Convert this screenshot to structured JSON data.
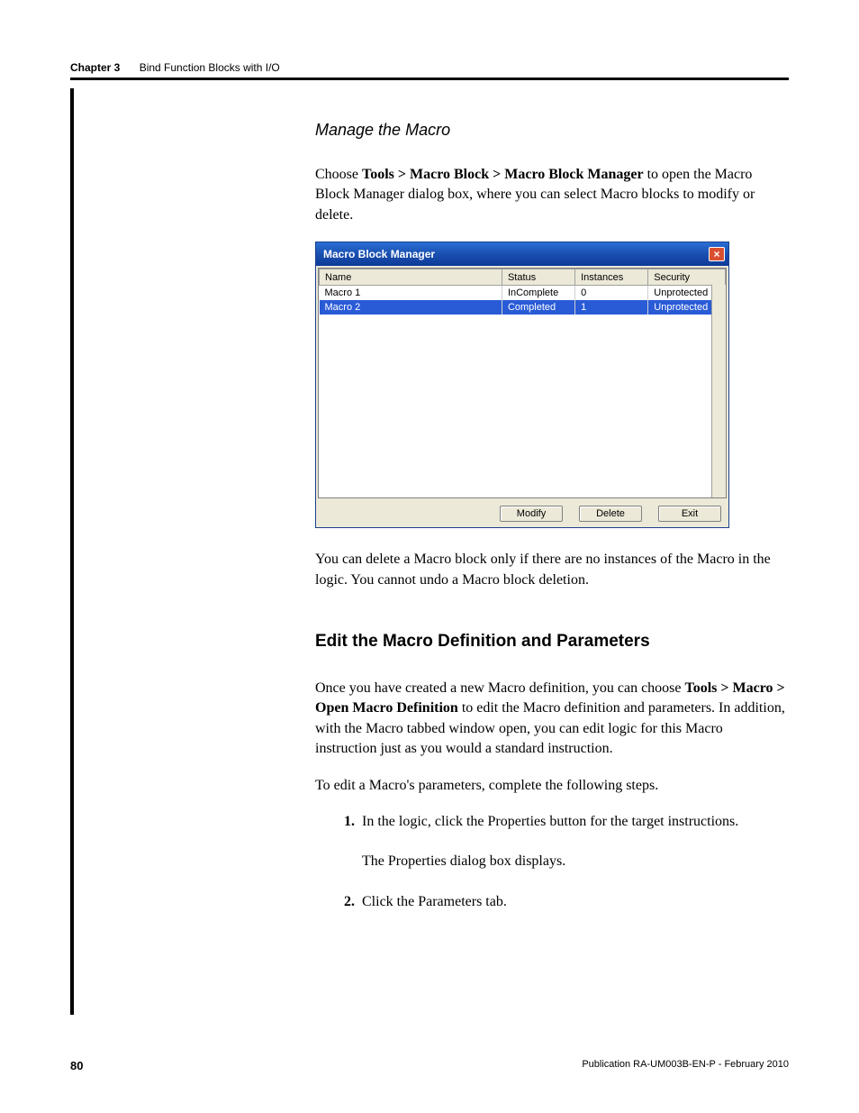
{
  "header": {
    "chapter_num": "Chapter 3",
    "chapter_title": "Bind Function Blocks with I/O"
  },
  "subheading_manage": "Manage the Macro",
  "para1_pre": "Choose ",
  "para1_bold": "Tools > Macro Block > Macro Block Manager",
  "para1_post": " to open the Macro Block Manager dialog box, where you can select Macro blocks to modify or delete.",
  "dialog": {
    "title": "Macro Block Manager",
    "columns": {
      "c0": "Name",
      "c1": "Status",
      "c2": "Instances",
      "c3": "Security"
    },
    "rows": [
      {
        "name": "Macro 1",
        "status": "InComplete",
        "instances": "0",
        "security": "Unprotected",
        "selected": false
      },
      {
        "name": "Macro 2",
        "status": "Completed",
        "instances": "1",
        "security": "Unprotected",
        "selected": true
      }
    ],
    "buttons": {
      "modify": "Modify",
      "delete": "Delete",
      "exit": "Exit"
    }
  },
  "para2": "You can delete a Macro block only if there are no instances of the Macro in the logic. You cannot undo a Macro block deletion.",
  "section_heading": "Edit the Macro Definition and Parameters",
  "para3_pre": "Once you have created a new Macro definition, you can choose ",
  "para3_bold": "Tools > Macro > Open Macro Definition",
  "para3_post": " to edit the Macro definition and parameters. In addition, with the Macro tabbed window open, you can edit logic for this Macro instruction just as you would a standard instruction.",
  "para4": "To edit a Macro's parameters, complete the following steps.",
  "steps": {
    "s1_num": "1.",
    "s1_body": "In the logic, click the Properties button for the target instructions.",
    "s1_sub": "The Properties dialog box displays.",
    "s2_num": "2.",
    "s2_body": "Click the Parameters tab."
  },
  "footer": {
    "page_num": "80",
    "pub": "Publication RA-UM003B-EN-P - February 2010"
  }
}
